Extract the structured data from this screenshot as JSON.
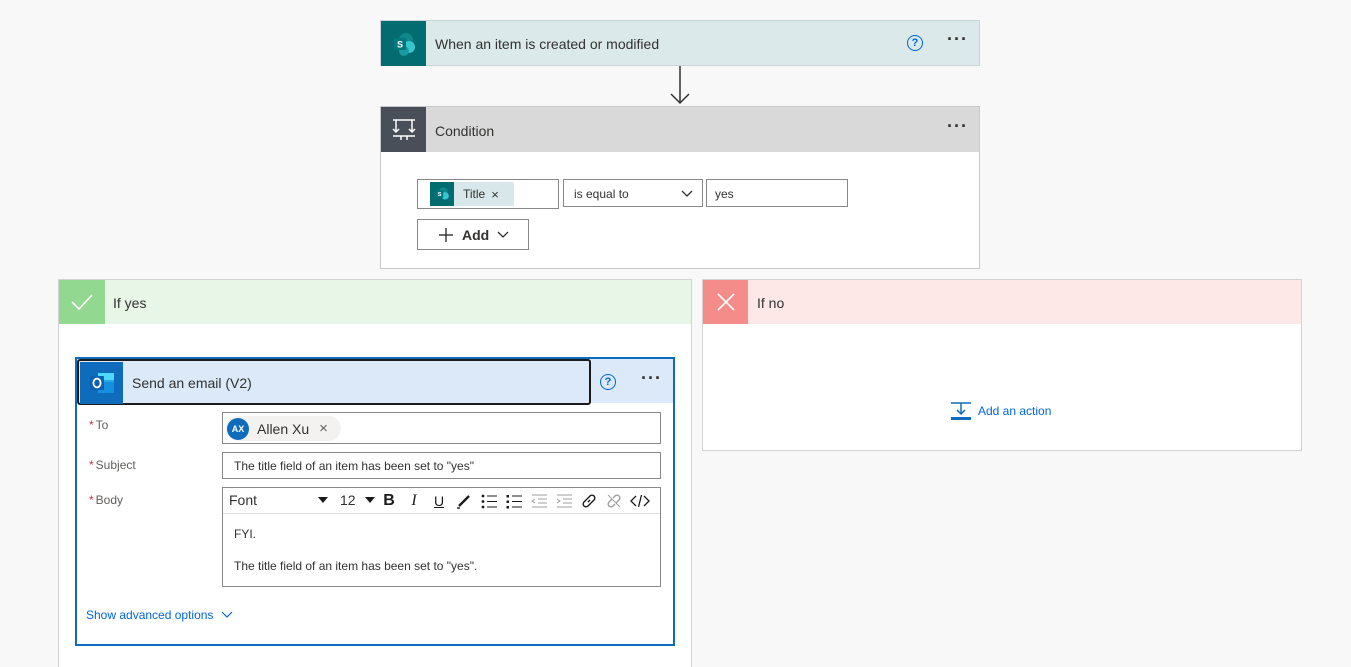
{
  "trigger": {
    "title": "When an item is created or modified",
    "icon": "sharepoint-icon",
    "help": "?"
  },
  "condition": {
    "title": "Condition",
    "icon": "condition-icon",
    "token_label": "Title",
    "operator": "is equal to",
    "value": "yes",
    "add_label": "Add"
  },
  "yes_branch": {
    "title": "If yes",
    "icon": "check-icon"
  },
  "no_branch": {
    "title": "If no",
    "icon": "close-icon",
    "add_action_label": "Add an action"
  },
  "email": {
    "title": "Send an email (V2)",
    "icon": "outlook-icon",
    "help": "?",
    "to_label": "To",
    "to_initials": "AX",
    "to_name": "Allen Xu",
    "subject_label": "Subject",
    "subject_value": "The title field of an item has been  set to \"yes\"",
    "body_label": "Body",
    "font_value": "Font",
    "size_value": "12",
    "body_line1": "FYI.",
    "body_line2": "The title field of an item has been set to \"yes\".",
    "advanced_label": "Show advanced options"
  },
  "colors": {
    "accent": "#0f6cbd",
    "sharepoint": "#036c70",
    "yes": "#92d891",
    "no": "#f48c8a"
  }
}
